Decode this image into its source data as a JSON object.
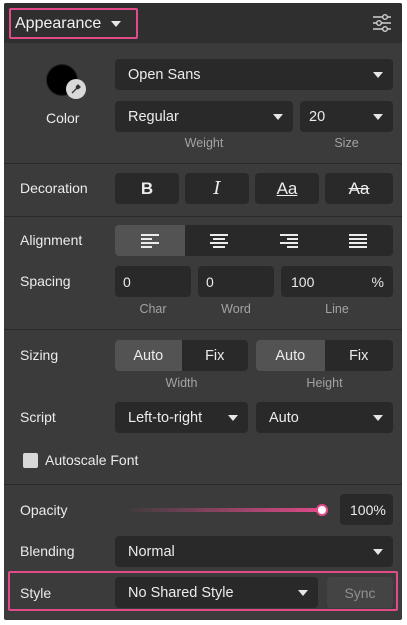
{
  "header": {
    "title": "Appearance",
    "settings_icon": "sliders-icon"
  },
  "color": {
    "label": "Color",
    "swatch": "#000000",
    "accent": "#e14b8a"
  },
  "font": {
    "family": "Open Sans",
    "weight": "Regular",
    "size": "20",
    "weight_caption": "Weight",
    "size_caption": "Size"
  },
  "decoration": {
    "label": "Decoration",
    "bold": "B",
    "italic": "I",
    "underline": "Aa",
    "strikethrough": "Aa"
  },
  "alignment": {
    "label": "Alignment",
    "selected": "left"
  },
  "spacing": {
    "label": "Spacing",
    "char": "0",
    "word": "0",
    "line": "100",
    "line_unit": "%",
    "char_caption": "Char",
    "word_caption": "Word",
    "line_caption": "Line"
  },
  "sizing": {
    "label": "Sizing",
    "width_auto": "Auto",
    "width_fix": "Fix",
    "height_auto": "Auto",
    "height_fix": "Fix",
    "width_caption": "Width",
    "height_caption": "Height"
  },
  "script": {
    "label": "Script",
    "direction": "Left-to-right",
    "mode": "Auto"
  },
  "autoscale": {
    "label": "Autoscale Font",
    "checked": false
  },
  "opacity": {
    "label": "Opacity",
    "value": "100%",
    "fraction": 1.0
  },
  "blending": {
    "label": "Blending",
    "value": "Normal"
  },
  "style": {
    "label": "Style",
    "value": "No Shared Style",
    "sync": "Sync"
  }
}
